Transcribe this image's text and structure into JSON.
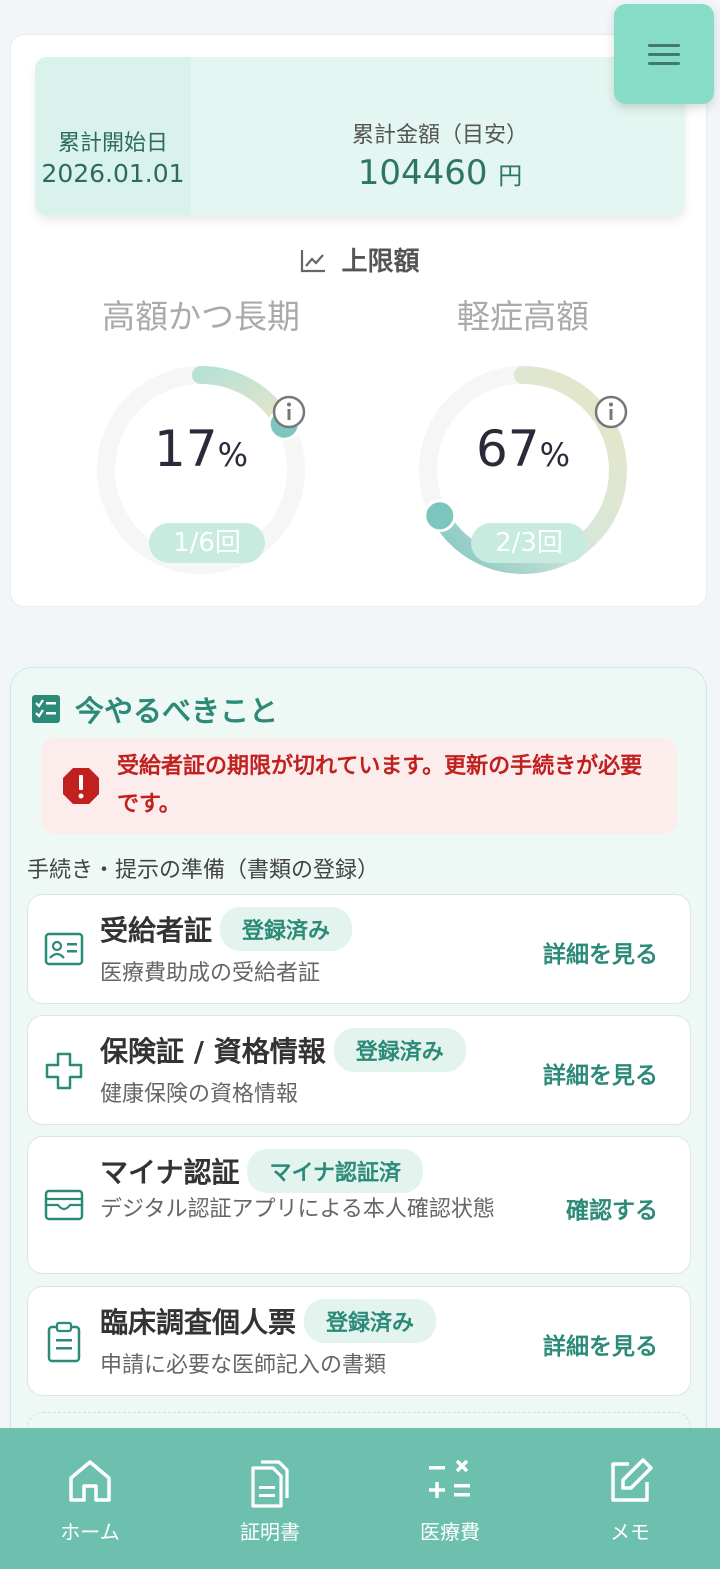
{
  "summary": {
    "start_label": "累計開始日",
    "start_value": "2026.01.01",
    "total_label": "累計金額（目安）",
    "total_value": "104460",
    "total_unit": "円"
  },
  "limits": {
    "title": "上限額",
    "gauges": [
      {
        "name": "高額かつ長期",
        "percent": "17",
        "percent_sign": "%",
        "count": "1/6回",
        "fraction": 0.17
      },
      {
        "name": "軽症高額",
        "percent": "67",
        "percent_sign": "%",
        "count": "2/3回",
        "fraction": 0.67
      }
    ]
  },
  "todo": {
    "title": "今やるべきこと",
    "alert": "受給者証の期限が切れています。更新の手続きが必要です。",
    "section_label": "手続き・提示の準備（書類の登録）",
    "items": [
      {
        "title": "受給者証",
        "badge": "登録済み",
        "desc": "医療費助成の受給者証",
        "action": "詳細を見る",
        "icon": "id-card-icon"
      },
      {
        "title": "保険証 / 資格情報",
        "badge": "登録済み",
        "desc": "健康保険の資格情報",
        "action": "詳細を見る",
        "icon": "medical-cross-icon"
      },
      {
        "title": "マイナ認証",
        "badge": "マイナ認証済",
        "desc": "デジタル認証アプリによる本人確認状態",
        "action": "確認する",
        "icon": "wallet-icon"
      },
      {
        "title": "臨床調査個人票",
        "badge": "登録済み",
        "desc": "申請に必要な医師記入の書類",
        "action": "詳細を見る",
        "icon": "clipboard-icon"
      }
    ]
  },
  "nav": {
    "items": [
      {
        "label": "ホーム",
        "icon": "home-icon"
      },
      {
        "label": "証明書",
        "icon": "documents-icon"
      },
      {
        "label": "医療費",
        "icon": "calculator-icon"
      },
      {
        "label": "メモ",
        "icon": "edit-icon"
      }
    ]
  },
  "colors": {
    "accent": "#2c8a78",
    "nav_bg": "#6cc0ad",
    "alert_text": "#c0201e",
    "alert_bg": "#fdecec"
  }
}
